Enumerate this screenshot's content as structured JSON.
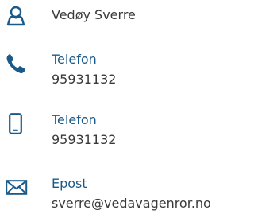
{
  "contact": {
    "name": "Vedøy Sverre",
    "phone": {
      "label": "Telefon",
      "value": "95931132"
    },
    "mobile": {
      "label": "Telefon",
      "value": "95931132"
    },
    "email": {
      "label": "Epost",
      "value": "sverre@vedavagenror.no"
    }
  },
  "icons": {
    "person": "person-icon",
    "phone": "phone-icon",
    "mobile": "mobile-phone-icon",
    "email": "envelope-icon"
  },
  "colors": {
    "icon": "#1a5a8a",
    "label": "#1a5a8a",
    "text": "#3a3a3a"
  }
}
